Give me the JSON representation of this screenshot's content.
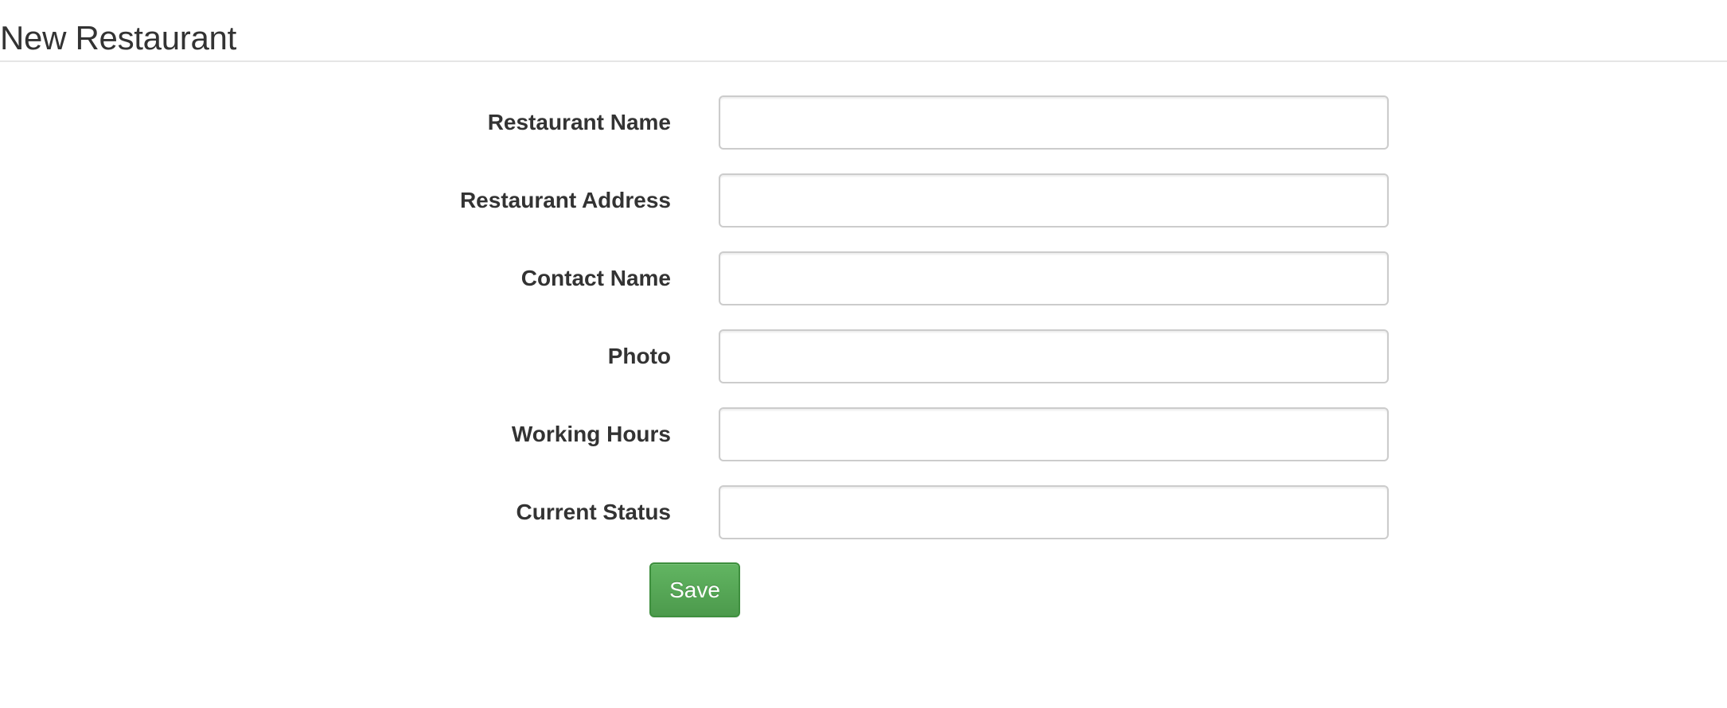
{
  "header": {
    "title": "New Restaurant"
  },
  "form": {
    "fields": [
      {
        "label": "Restaurant Name",
        "value": "",
        "placeholder": ""
      },
      {
        "label": "Restaurant Address",
        "value": "",
        "placeholder": ""
      },
      {
        "label": "Contact Name",
        "value": "",
        "placeholder": ""
      },
      {
        "label": "Photo",
        "value": "",
        "placeholder": ""
      },
      {
        "label": "Working Hours",
        "value": "",
        "placeholder": ""
      },
      {
        "label": "Current Status",
        "value": "",
        "placeholder": ""
      }
    ],
    "save_label": "Save"
  },
  "colors": {
    "save_button": "#5cb85c",
    "title_text": "#333333",
    "divider": "#e5e5e5",
    "input_border": "#cccccc"
  }
}
